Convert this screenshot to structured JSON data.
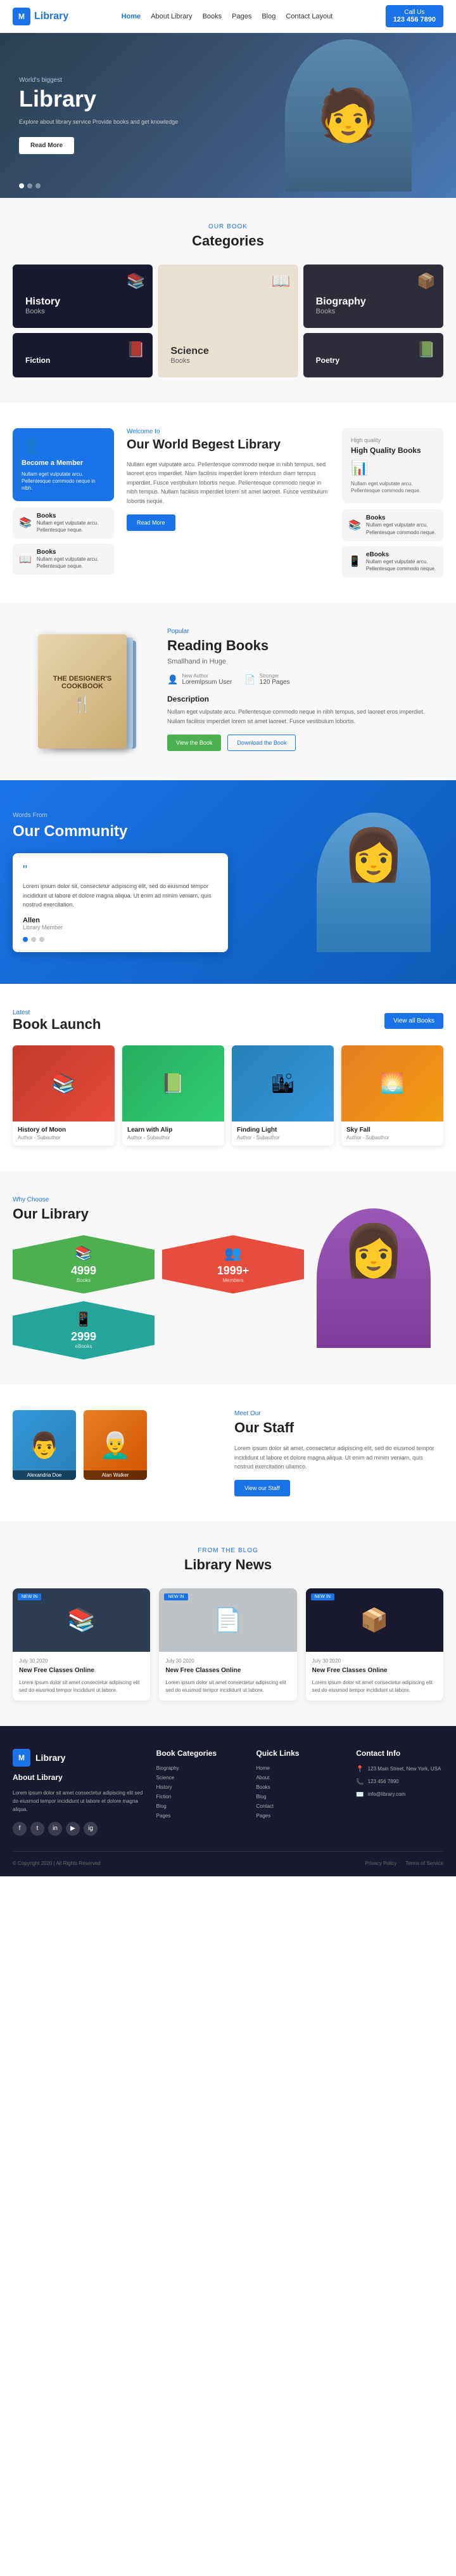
{
  "navbar": {
    "logo_letter": "M",
    "logo_text": "Library",
    "links": [
      "Home",
      "About Library",
      "Books",
      "Pages",
      "Blog",
      "Contact Layout"
    ],
    "active_link": "Home",
    "contact_label": "Call Us",
    "contact_phone": "123 456 7890"
  },
  "hero": {
    "subtitle": "World's biggest",
    "title": "Library",
    "description": "Explore about library service Provide books and get knowledge",
    "btn_label": "Read More",
    "dots": 3
  },
  "categories": {
    "label": "Our Book",
    "title": "Categories",
    "items": [
      {
        "name": "History",
        "sub": "Books",
        "theme": "dark"
      },
      {
        "name": "Science",
        "sub": "Books",
        "theme": "light"
      },
      {
        "name": "Biography",
        "sub": "Books",
        "theme": "darkgray"
      }
    ]
  },
  "about": {
    "welcome": "Welcome to",
    "title": "Our World Begest Library",
    "text": "Nullam eget vulputate arcu. Pellentesque commodo neque in nibh tempus, sed laoreet eros imperdiet. Nam facilisis imperdiet lorem interdum diam tempus imperdiet. Fusce vestibulum lobortis neque. Pellentesque commodo neque in nibh tempus. Nullam facilisis imperdiet lorem sit amet laoreet. Fusce vestibulum lobortis neque.",
    "btn": "Read More",
    "member_title": "Become a Member",
    "member_desc": "Nullam eget vulputate arcu. Pellentesque commodo neque in nibh.",
    "left_cards": [
      {
        "title": "Books",
        "desc": "Nullam eget vulputate arcu. Pellentesque neque."
      },
      {
        "title": "Books",
        "desc": "Nullam eget vulputate arcu. Pellentesque neque."
      }
    ],
    "right_title": "High Quality Books",
    "right_desc": "Nullam eget vulputate arcu. Pellentesque commodo neque.",
    "right_card_desc": "Nullam eget vulputate arcu. Pellentesque commodo neque.",
    "right_small": "Nullam eget vulputate arcu. Pellentesque commodo neque."
  },
  "reading": {
    "popular_label": "Popular",
    "title": "Reading Books",
    "subtitle": "Smallhand in Huge",
    "book_title": "THE DESIGNER'S COOKBOOK",
    "author_label": "New Author",
    "author_name": "Loremlpsum User",
    "pages_label": "Stronger",
    "pages_count": "120 Pages",
    "desc_title": "Description",
    "desc_text": "Nullam eget vulputate arcu. Pellentesque commodo neque in nibh tempus, sed laoreet eros imperdiet. Nullam facilisis imperdiet lorem sit amet laoreet. Fusce vestibulum lobortis.",
    "btn_buy": "View the Book",
    "btn_download": "Download the Book"
  },
  "community": {
    "from_label": "Words From",
    "title": "Our Community",
    "testimonial": "Lorem ipsum dolor sit, consectetur adipiscing elit, sed do eiusmod tempor incididunt ut labore et dolore magna aliqua. Ut enim ad minim veniam, quis nostrud exercitation.",
    "author": "Allen",
    "author_role": "Library Member",
    "dots": 3
  },
  "book_launch": {
    "label": "Latest",
    "title": "Book Launch",
    "view_all": "View all Books",
    "books": [
      {
        "title": "History of Moon",
        "author": "Author - Subauthor",
        "color": "red",
        "icon": "📚"
      },
      {
        "title": "Learn with Alip",
        "author": "Author - Subauthor",
        "color": "green",
        "icon": "📗"
      },
      {
        "title": "Finding Light",
        "author": "Author - Subauthor",
        "color": "blue",
        "icon": "🏙"
      },
      {
        "title": "Sky Fall",
        "author": "Author - Subauthor",
        "color": "yellow",
        "icon": "🌅"
      }
    ]
  },
  "why_choose": {
    "label": "Why Choose",
    "title": "Our Library",
    "stats": [
      {
        "number": "4999",
        "label": "Books",
        "icon": "📚",
        "color": "green"
      },
      {
        "number": "1999+",
        "label": "Members",
        "icon": "👥",
        "color": "red"
      },
      {
        "number": "2999",
        "label": "eBooks",
        "icon": "📱",
        "color": "teal"
      }
    ]
  },
  "staff": {
    "label": "Meet Our",
    "title": "Our Staff",
    "desc": "Lorem ipsum dolor sit amet, consectetur adipiscing elit, sed do eiusmod tempor incididunt ut labore et dolore magna aliqua. Ut enim ad minim veniam, quis nostrud exercitation ullamco.",
    "btn": "View our Staff",
    "members": [
      {
        "name": "Alexandria Doe",
        "color": "blue-bg"
      },
      {
        "name": "Alan Walker",
        "color": "orange-bg"
      }
    ]
  },
  "news": {
    "label": "From the Blog",
    "title": "Library News",
    "badge": "NEW IN",
    "articles": [
      {
        "date": "July 30 2020",
        "title": "New Free Classes Online",
        "text": "Lorem ipsum dolor sit amet consectetur adipiscing elit sed do eiusmod tempor incididunt ut labore.",
        "bg": "dark-bg",
        "icon": "📚"
      },
      {
        "date": "July 30 2020",
        "title": "New Free Classes Online",
        "text": "Lorem ipsum dolor sit amet consectetur adipiscing elit sed do eiusmod tempor incididunt ut labore.",
        "bg": "light-bg",
        "icon": "📄"
      },
      {
        "date": "July 30 2020",
        "title": "New Free Classes Online",
        "text": "Lorem ipsum dolor sit amet consectetur adipiscing elit sed do eiusmod tempor incididunt ut labore.",
        "bg": "dark2-bg",
        "icon": "📦"
      }
    ]
  },
  "footer": {
    "logo_letter": "M",
    "logo_text": "Library",
    "about_title": "About Library",
    "about_text": "Lorem ipsum dolor sit amet consectetur adipiscing elit sed do eiusmod tempor incididunt ut labore et dolore magna aliqua.",
    "categories_title": "Book Categories",
    "categories": [
      "Biography",
      "Science",
      "History",
      "Fiction",
      "Blog",
      "Pages"
    ],
    "quick_links_title": "Quick Links",
    "quick_links": [
      "Home",
      "About",
      "Books",
      "Blog",
      "Contact",
      "Pages"
    ],
    "contact_title": "Contact Info",
    "contact_items": [
      {
        "icon": "📍",
        "text": "123 Main Street, New York, USA"
      },
      {
        "icon": "📞",
        "text": "123 456 7890"
      },
      {
        "icon": "✉️",
        "text": "info@library.com"
      }
    ],
    "social_icons": [
      "f",
      "t",
      "in",
      "yt",
      "ig"
    ],
    "copyright": "© Copyright 2020 | All Rights Reserved",
    "bottom_links": [
      "Privacy Policy",
      "Terms of Service"
    ]
  }
}
